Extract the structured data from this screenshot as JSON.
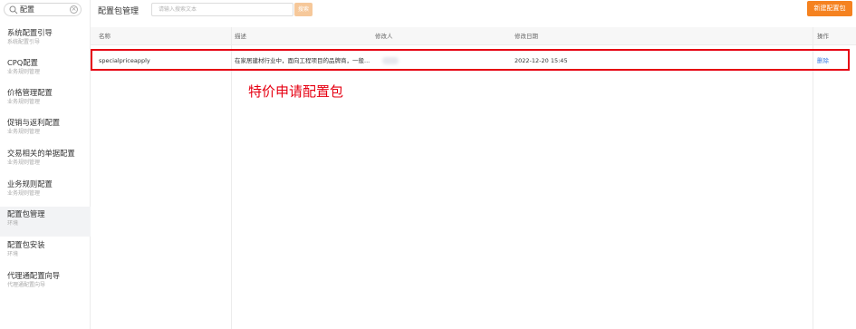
{
  "sidebar": {
    "search_value": "配置",
    "items": [
      {
        "title": "系统配置引导",
        "subtitle": "系统配置引导",
        "active": false
      },
      {
        "title": "CPQ配置",
        "subtitle": "业务规则管理",
        "active": false
      },
      {
        "title": "价格管理配置",
        "subtitle": "业务规则管理",
        "active": false
      },
      {
        "title": "促销与返利配置",
        "subtitle": "业务规则管理",
        "active": false
      },
      {
        "title": "交易相关的单据配置",
        "subtitle": "业务规则管理",
        "active": false
      },
      {
        "title": "业务规则配置",
        "subtitle": "业务规则管理",
        "active": false
      },
      {
        "title": "配置包管理",
        "subtitle": "环境",
        "active": true
      },
      {
        "title": "配置包安装",
        "subtitle": "环境",
        "active": false
      },
      {
        "title": "代理通配置向导",
        "subtitle": "代理通配置向导",
        "active": false
      }
    ]
  },
  "header": {
    "title": "配置包管理",
    "search_placeholder": "请输入搜索文本",
    "search_button": "搜索",
    "new_button": "新建配置包"
  },
  "table": {
    "columns": [
      "名称",
      "描述",
      "修改人",
      "修改日期",
      "操作"
    ],
    "rows": [
      {
        "name": "specialpriceapply",
        "description": "在家居建材行业中，面向工程项目的品牌商，一般...",
        "modifier": "",
        "date": "2022-12-20 15:45",
        "action": "删除"
      }
    ]
  },
  "annotation": {
    "text": "特价申请配置包",
    "color": "#e60012"
  },
  "colors": {
    "accent": "#f58220",
    "link": "#3b7be0",
    "highlight": "#e60012"
  }
}
